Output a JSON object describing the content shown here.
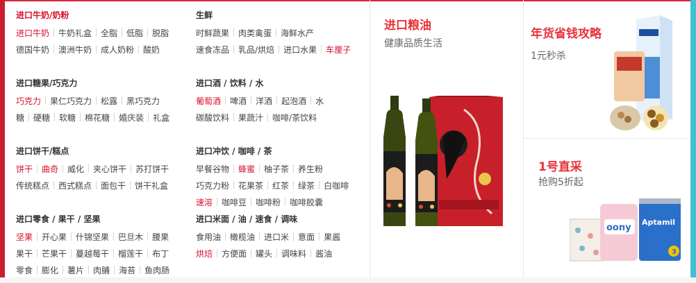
{
  "menu": {
    "left": [
      {
        "title": "进口牛奶/奶粉",
        "title_red": true,
        "rows": [
          [
            {
              "t": "进口牛奶",
              "red": true
            },
            {
              "t": "牛奶礼盒"
            },
            {
              "t": "全脂"
            },
            {
              "t": "低脂"
            },
            {
              "t": "脱脂"
            }
          ],
          [
            {
              "t": "德国牛奶"
            },
            {
              "t": "澳洲牛奶"
            },
            {
              "t": "成人奶粉"
            },
            {
              "t": "酸奶"
            }
          ]
        ]
      },
      {
        "title": "进口糖果/巧克力",
        "rows": [
          [
            {
              "t": "巧克力",
              "red": true
            },
            {
              "t": "果仁巧克力"
            },
            {
              "t": "松露"
            },
            {
              "t": "黑巧克力"
            }
          ],
          [
            {
              "t": "糖"
            },
            {
              "t": "硬糖"
            },
            {
              "t": "软糖"
            },
            {
              "t": "棉花糖"
            },
            {
              "t": "婚庆装"
            },
            {
              "t": "礼盒"
            }
          ]
        ]
      },
      {
        "title": "进口饼干/糕点",
        "rows": [
          [
            {
              "t": "饼干",
              "red": true
            },
            {
              "t": "曲奇",
              "red": true
            },
            {
              "t": "威化"
            },
            {
              "t": "夹心饼干"
            },
            {
              "t": "苏打饼干"
            }
          ],
          [
            {
              "t": "传统糕点"
            },
            {
              "t": "西式糕点"
            },
            {
              "t": "面包干"
            },
            {
              "t": "饼干礼盒"
            }
          ]
        ]
      },
      {
        "title": "进口零食 / 果干 / 坚果",
        "rows": [
          [
            {
              "t": "坚果",
              "red": true
            },
            {
              "t": "开心果"
            },
            {
              "t": "什锦坚果"
            },
            {
              "t": "巴旦木"
            },
            {
              "t": "腰果"
            }
          ],
          [
            {
              "t": "果干"
            },
            {
              "t": "芒果干"
            },
            {
              "t": "蔓越莓干"
            },
            {
              "t": "榴莲干"
            },
            {
              "t": "布丁"
            }
          ],
          [
            {
              "t": "零食"
            },
            {
              "t": "膨化"
            },
            {
              "t": "薯片"
            },
            {
              "t": "肉脯"
            },
            {
              "t": "海苔"
            },
            {
              "t": "鱼肉肠"
            }
          ]
        ]
      }
    ],
    "right": [
      {
        "title": "生鲜",
        "rows": [
          [
            {
              "t": "时鲜蔬果"
            },
            {
              "t": "肉类禽蛋"
            },
            {
              "t": "海鲜水产"
            }
          ],
          [
            {
              "t": "速食冻品"
            },
            {
              "t": "乳品/烘焙"
            },
            {
              "t": "进口水果"
            },
            {
              "t": "车厘子",
              "red": true
            }
          ]
        ]
      },
      {
        "title": "进口酒 / 饮料 / 水",
        "rows": [
          [
            {
              "t": "葡萄酒",
              "red": true
            },
            {
              "t": "啤酒"
            },
            {
              "t": "洋酒"
            },
            {
              "t": "起泡酒"
            },
            {
              "t": "水"
            }
          ],
          [
            {
              "t": "碳酸饮料"
            },
            {
              "t": "果蔬汁"
            },
            {
              "t": "咖啡/茶饮料"
            }
          ]
        ]
      },
      {
        "title": "进口冲饮 / 咖啡 / 茶",
        "rows": [
          [
            {
              "t": "早餐谷物"
            },
            {
              "t": "蜂蜜",
              "red": true
            },
            {
              "t": "柚子茶"
            },
            {
              "t": "养生粉"
            }
          ],
          [
            {
              "t": "巧克力粉"
            },
            {
              "t": "花果茶"
            },
            {
              "t": "红茶"
            },
            {
              "t": "绿茶"
            },
            {
              "t": "白咖啡"
            }
          ],
          [
            {
              "t": "速溶",
              "red": true
            },
            {
              "t": "咖啡豆"
            },
            {
              "t": "咖啡粉"
            },
            {
              "t": "咖啡胶囊"
            }
          ]
        ]
      },
      {
        "title": "进口米面 / 油 / 速食 / 调味",
        "rows": [
          [
            {
              "t": "食用油"
            },
            {
              "t": "橄榄油"
            },
            {
              "t": "进口米"
            },
            {
              "t": "意面"
            },
            {
              "t": "果酱"
            }
          ],
          [
            {
              "t": "烘焙",
              "red": true
            },
            {
              "t": "方便面"
            },
            {
              "t": "罐头"
            },
            {
              "t": "调味料"
            },
            {
              "t": "酱油"
            }
          ]
        ]
      }
    ]
  },
  "promos": {
    "oil": {
      "title": "进口粮油",
      "subtitle": "健康品质生活",
      "image": "olive-oil-gift-box-image"
    },
    "newyear": {
      "title": "年货省钱攻略",
      "subtitle": "1元秒杀",
      "image": "new-year-snacks-image"
    },
    "direct": {
      "title": "1号直采",
      "subtitle": "抢购5折起",
      "image": "baby-products-image"
    }
  },
  "colors": {
    "accent_red": "#d8102c",
    "promo_red": "#e8323c",
    "left_bar": "#c81e2e",
    "right_bar": "#3fc4cf"
  }
}
